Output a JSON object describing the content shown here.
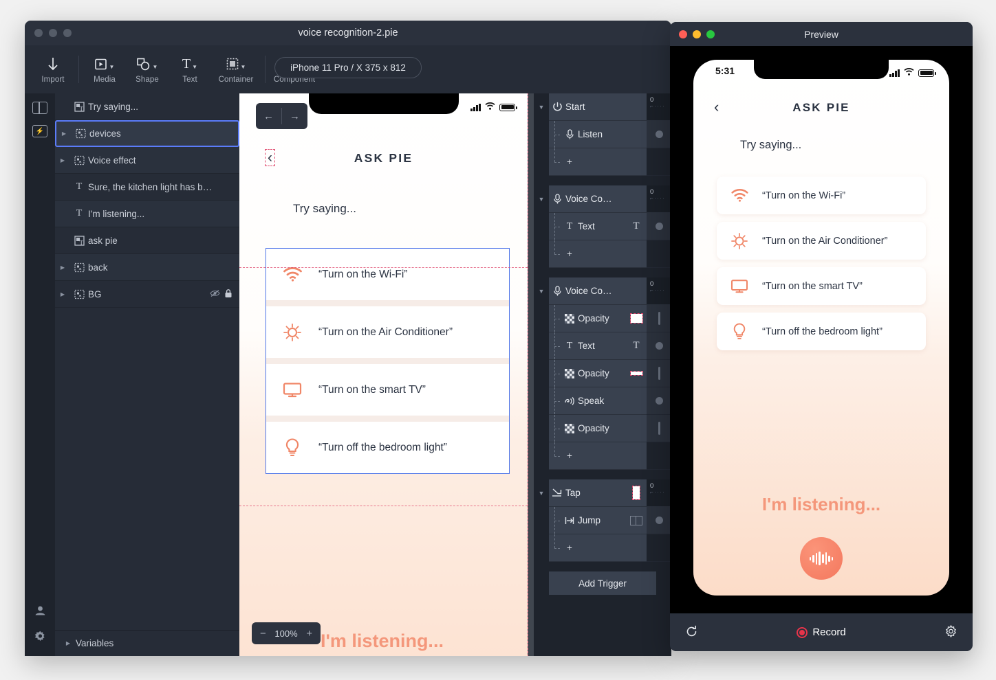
{
  "editor": {
    "window_title": "voice recognition-2.pie",
    "toolbar": {
      "items": [
        {
          "label": "Import",
          "icon": "download-arrow-icon",
          "caret": false
        },
        {
          "label": "Media",
          "icon": "media-play-icon",
          "caret": true
        },
        {
          "label": "Shape",
          "icon": "shape-icon",
          "caret": true
        },
        {
          "label": "Text",
          "icon": "text-T-icon",
          "caret": true
        },
        {
          "label": "Container",
          "icon": "container-icon",
          "caret": true
        },
        {
          "label": "Component",
          "icon": "component-bolt-icon",
          "caret": false
        }
      ],
      "device_pill": "iPhone 11 Pro / X  375 x 812"
    },
    "rail": {
      "top_icons": [
        "split-panel-icon",
        "component-bolt-icon"
      ],
      "bottom_icons": [
        "account-person-icon",
        "settings-gear-icon"
      ]
    },
    "layers": {
      "items": [
        {
          "name": "Try saying...",
          "icon": "text-image-layer-icon",
          "expandable": false,
          "selected": false,
          "hidden": false,
          "locked": false
        },
        {
          "name": "devices",
          "icon": "group-layer-icon",
          "expandable": true,
          "selected": true,
          "hidden": false,
          "locked": false
        },
        {
          "name": "Voice effect",
          "icon": "group-layer-icon",
          "expandable": true,
          "selected": false,
          "hidden": false,
          "locked": false
        },
        {
          "name": "Sure, the kitchen light has b…",
          "icon": "text-layer-icon",
          "expandable": false,
          "selected": false,
          "hidden": false,
          "locked": false
        },
        {
          "name": "I'm listening...",
          "icon": "text-layer-icon",
          "expandable": false,
          "selected": false,
          "hidden": false,
          "locked": false
        },
        {
          "name": "ask pie",
          "icon": "text-image-layer-icon",
          "expandable": false,
          "selected": false,
          "hidden": false,
          "locked": false
        },
        {
          "name": "back",
          "icon": "group-layer-icon",
          "expandable": true,
          "selected": false,
          "hidden": false,
          "locked": false
        },
        {
          "name": "BG",
          "icon": "group-layer-icon",
          "expandable": true,
          "selected": false,
          "hidden": true,
          "locked": true
        }
      ],
      "variables_label": "Variables"
    },
    "canvas": {
      "nav_back_icon": "arrow-left-icon",
      "nav_forward_icon": "arrow-right-icon",
      "zoom_minus": "−",
      "zoom_level": "100%",
      "zoom_plus": "+",
      "artboard": {
        "back_chevron": "‹",
        "screen_title": "ASK PIE",
        "prompt": "Try saying...",
        "cards": [
          {
            "icon": "wifi-icon",
            "text": "“Turn on the Wi-Fi”"
          },
          {
            "icon": "air-conditioner-icon",
            "text": "“Turn on the Air Conditioner”"
          },
          {
            "icon": "tv-icon",
            "text": "“Turn on the smart TV”"
          },
          {
            "icon": "lightbulb-icon",
            "text": "“Turn off the bedroom light”"
          }
        ],
        "listening_text": "I'm listening..."
      }
    },
    "triggers": {
      "add_trigger_label": "Add Trigger",
      "plus_label": "+",
      "groups": [
        {
          "name": "Start",
          "icon": "power-start-icon",
          "meter": "0",
          "thumb": "none",
          "actions": [
            {
              "name": "Listen",
              "icon": "mic-icon",
              "thumb": "none",
              "state": "dot"
            }
          ]
        },
        {
          "name": "Voice Co…",
          "icon": "mic-icon",
          "meter": "0",
          "thumb": "none",
          "actions": [
            {
              "name": "Text",
              "icon": "text-T-icon",
              "thumb": "T",
              "state": "dot"
            }
          ]
        },
        {
          "name": "Voice Co…",
          "icon": "mic-icon",
          "meter": "0",
          "thumb": "none",
          "actions": [
            {
              "name": "Opacity",
              "icon": "checker-opacity-icon",
              "thumb": "box",
              "state": "bar"
            },
            {
              "name": "Text",
              "icon": "text-T-icon",
              "thumb": "T",
              "state": "dot"
            },
            {
              "name": "Opacity",
              "icon": "checker-opacity-icon",
              "thumb": "bar",
              "state": "bar"
            },
            {
              "name": "Speak",
              "icon": "speak-icon",
              "thumb": "none",
              "state": "dot"
            },
            {
              "name": "Opacity",
              "icon": "checker-opacity-icon",
              "thumb": "none",
              "state": "bar"
            }
          ]
        },
        {
          "name": "Tap",
          "icon": "tap-arrow-icon",
          "meter": "0",
          "thumb": "tall",
          "actions": [
            {
              "name": "Jump",
              "icon": "jump-icon",
              "thumb": "jump",
              "state": "dot"
            }
          ]
        }
      ]
    }
  },
  "preview": {
    "window_title": "Preview",
    "traffic_colors": [
      "#ff5f57",
      "#febc2e",
      "#28c840"
    ],
    "phone": {
      "time": "5:31",
      "back_chevron": "‹",
      "screen_title": "ASK PIE",
      "prompt": "Try saying...",
      "cards": [
        {
          "icon": "wifi-icon",
          "text": "“Turn on the Wi-Fi”"
        },
        {
          "icon": "air-conditioner-icon",
          "text": "“Turn on the Air Conditioner”"
        },
        {
          "icon": "tv-icon",
          "text": "“Turn on the smart TV”"
        },
        {
          "icon": "lightbulb-icon",
          "text": "“Turn off the bedroom light”"
        }
      ],
      "listening_text": "I'm listening...",
      "mic_icon": "waveform-icon"
    },
    "bottom_bar": {
      "reload_icon": "reload-icon",
      "record_label": "Record",
      "settings_icon": "settings-gear-icon"
    }
  },
  "colors": {
    "accent_coral": "#f08667",
    "selection_blue": "#4a72e8",
    "guide_red": "#e04a6e",
    "panel_dark": "#262c37"
  }
}
